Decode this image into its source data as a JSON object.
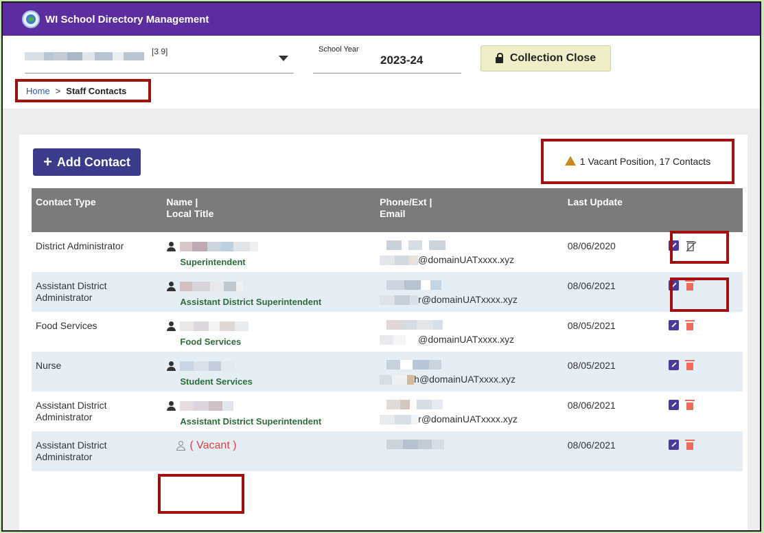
{
  "app": {
    "title": "WI School Directory Management"
  },
  "header": {
    "district_code": "[3   9]",
    "school_year_label": "School Year",
    "school_year_value": "2023-24",
    "collection_button": "Collection Close"
  },
  "breadcrumb": {
    "home": "Home",
    "separator": ">",
    "current": "Staff Contacts"
  },
  "toolbar": {
    "add_contact": "Add Contact"
  },
  "summary": {
    "text": "1 Vacant Position, 17 Contacts"
  },
  "table": {
    "headers": {
      "contact_type": "Contact Type",
      "name_line1": "Name |",
      "name_line2": "Local Title",
      "phone_line1": "Phone/Ext |",
      "phone_line2": "Email",
      "last_update": "Last Update"
    },
    "rows": [
      {
        "type": "District Administrator",
        "title": "Superintendent",
        "email": "@domainUATxxxx.xyz",
        "updated": "08/06/2020",
        "delete_disabled": true
      },
      {
        "type": "Assistant District Administrator",
        "title": "Assistant District Superintendent",
        "email": "r@domainUATxxxx.xyz",
        "updated": "08/06/2021",
        "delete_disabled": false
      },
      {
        "type": "Food Services",
        "title": "Food Services",
        "email": "@domainUATxxxx.xyz",
        "updated": "08/05/2021",
        "delete_disabled": false
      },
      {
        "type": "Nurse",
        "title": "Student Services",
        "email": "h@domainUATxxxx.xyz",
        "updated": "08/05/2021",
        "delete_disabled": false
      },
      {
        "type": "Assistant District Administrator",
        "title": "Assistant District Superintendent",
        "email": "r@domainUATxxxx.xyz",
        "updated": "08/06/2021",
        "delete_disabled": false
      },
      {
        "type": "Assistant District Administrator",
        "vacant": "( Vacant )",
        "updated": "08/06/2021",
        "delete_disabled": false
      }
    ]
  },
  "colors": {
    "topbar": "#5b2d9e",
    "accent_button": "#3b3b8c",
    "title_green": "#2e6b3b",
    "delete_red": "#ee6b5a",
    "highlight_red": "#a01010"
  }
}
